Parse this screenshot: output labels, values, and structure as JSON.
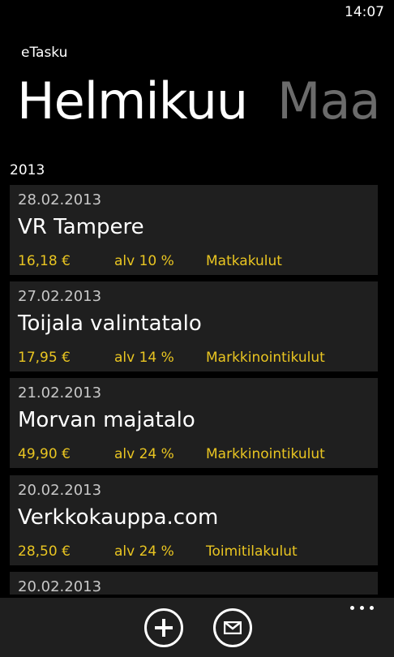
{
  "status_bar": {
    "time": "14:07"
  },
  "app": {
    "title": "eTasku"
  },
  "pivot": {
    "active": "Helmikuu",
    "next": "Maa"
  },
  "year": "2013",
  "receipts": [
    {
      "date": "28.02.2013",
      "name": "VR Tampere",
      "amount": "16,18 €",
      "vat": "alv 10 %",
      "category": "Matkakulut"
    },
    {
      "date": "27.02.2013",
      "name": "Toijala valintatalo",
      "amount": "17,95 €",
      "vat": "alv 14 %",
      "category": "Markkinointikulut"
    },
    {
      "date": "21.02.2013",
      "name": "Morvan majatalo",
      "amount": "49,90 €",
      "vat": "alv 24 %",
      "category": "Markkinointikulut"
    },
    {
      "date": "20.02.2013",
      "name": "Verkkokauppa.com",
      "amount": "28,50 €",
      "vat": "alv 24 %",
      "category": "Toimitilakulut"
    },
    {
      "date": "20.02.2013",
      "name": "",
      "amount": "",
      "vat": "",
      "category": ""
    }
  ],
  "app_bar": {
    "buttons": [
      {
        "icon": "add-icon"
      },
      {
        "icon": "mail-icon"
      }
    ],
    "more_icon": "ellipsis-icon"
  },
  "colors": {
    "background": "#000000",
    "card": "#1f1f1f",
    "accent": "#e9c521",
    "inactive_pivot": "#6b6b6b"
  }
}
